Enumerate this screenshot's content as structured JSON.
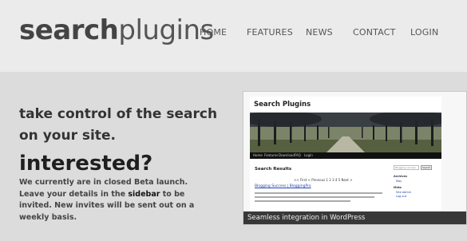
{
  "brand": {
    "bold": "search",
    "light": "plugins"
  },
  "nav": [
    {
      "label": "HOME"
    },
    {
      "label": "FEATURES"
    },
    {
      "label": "NEWS"
    },
    {
      "label": "CONTACT"
    },
    {
      "label": "LOGIN"
    }
  ],
  "hero": {
    "tagline": "take control of the search on your site.",
    "headline": "interested?",
    "desc_before": "We currently are in closed Beta launch. Leave your details in the ",
    "desc_strong": "sidebar",
    "desc_after": " to be invited. New invites will be sent out on a weekly basis."
  },
  "screenshot": {
    "site_title": "Search Plugins",
    "menu": [
      "Home",
      "Features",
      "Download",
      "FAQ",
      "Login"
    ],
    "results_heading": "Search Results",
    "pager": "<< First < Previous 1 2 3 4 5 Next >",
    "result_link": "Blogging Success | BloggingPro",
    "search_placeholder": "Blogging success",
    "search_button": "Search",
    "sidebar_archives": "Archives",
    "archives_item": "May",
    "sidebar_meta": "Meta",
    "meta_items": [
      "Site Admin",
      "Log out"
    ],
    "caption": "Seamless integration in WordPress"
  }
}
